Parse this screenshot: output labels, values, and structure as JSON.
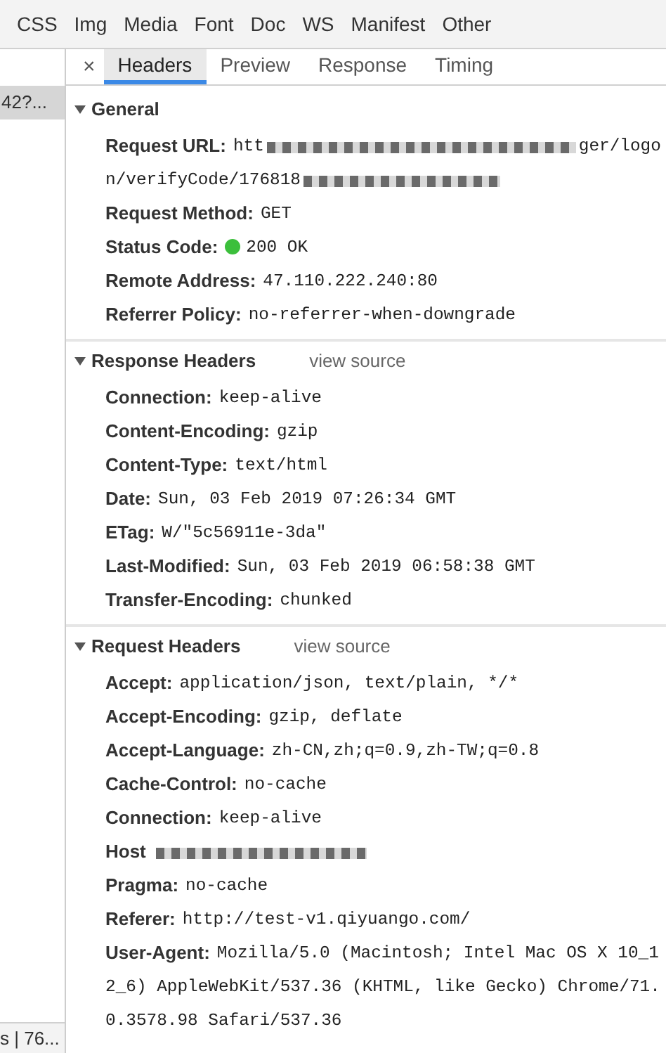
{
  "filter_bar": {
    "items": [
      "CSS",
      "Img",
      "Media",
      "Font",
      "Doc",
      "WS",
      "Manifest",
      "Other"
    ]
  },
  "request_list": {
    "items": [
      {
        "label": "42?...",
        "selected": true
      }
    ],
    "footer": "s | 76..."
  },
  "detail_tabs": {
    "close": "×",
    "tabs": [
      {
        "label": "Headers",
        "selected": true
      },
      {
        "label": "Preview",
        "selected": false
      },
      {
        "label": "Response",
        "selected": false
      },
      {
        "label": "Timing",
        "selected": false
      }
    ]
  },
  "sections": [
    {
      "title": "General",
      "expanded": true,
      "rows": [
        {
          "name": "Request URL:",
          "segments": [
            {
              "kind": "text",
              "text": "htt"
            },
            {
              "kind": "redacted"
            },
            {
              "kind": "text",
              "text": "ger/logo"
            },
            {
              "kind": "break"
            },
            {
              "kind": "text",
              "text": "n/verifyCode/176818"
            },
            {
              "kind": "redacted"
            }
          ]
        },
        {
          "name": "Request Method:",
          "value": "GET"
        },
        {
          "name": "Status Code:",
          "value": "200 OK",
          "status_dot": true
        },
        {
          "name": "Remote Address:",
          "value": "47.110.222.240:80"
        },
        {
          "name": "Referrer Policy:",
          "value": "no-referrer-when-downgrade"
        }
      ]
    },
    {
      "title": "Response Headers",
      "expanded": true,
      "link": "view source",
      "rows": [
        {
          "name": "Connection:",
          "value": "keep-alive"
        },
        {
          "name": "Content-Encoding:",
          "value": "gzip"
        },
        {
          "name": "Content-Type:",
          "value": "text/html"
        },
        {
          "name": "Date:",
          "value": "Sun, 03 Feb 2019 07:26:34 GMT"
        },
        {
          "name": "ETag:",
          "value": "W/\"5c56911e-3da\""
        },
        {
          "name": "Last-Modified:",
          "value": "Sun, 03 Feb 2019 06:58:38 GMT"
        },
        {
          "name": "Transfer-Encoding:",
          "value": "chunked"
        }
      ]
    },
    {
      "title": "Request Headers",
      "expanded": true,
      "link": "view source",
      "rows": [
        {
          "name": "Accept:",
          "value": "application/json, text/plain, */*"
        },
        {
          "name": "Accept-Encoding:",
          "value": "gzip, deflate"
        },
        {
          "name": "Accept-Language:",
          "value": "zh-CN,zh;q=0.9,zh-TW;q=0.8"
        },
        {
          "name": "Cache-Control:",
          "value": "no-cache"
        },
        {
          "name": "Connection:",
          "value": "keep-alive"
        },
        {
          "name": "Host",
          "segments": [
            {
              "kind": "redacted"
            }
          ]
        },
        {
          "name": "Pragma:",
          "value": "no-cache"
        },
        {
          "name": "Referer:",
          "value": "http://test-v1.qiyuango.com/"
        },
        {
          "name": "User-Agent:",
          "value": "Mozilla/5.0 (Macintosh; Intel Mac OS X 10_12_6) AppleWebKit/537.36 (KHTML, like Gecko) Chrome/71.0.3578.98 Safari/537.36"
        }
      ]
    }
  ]
}
